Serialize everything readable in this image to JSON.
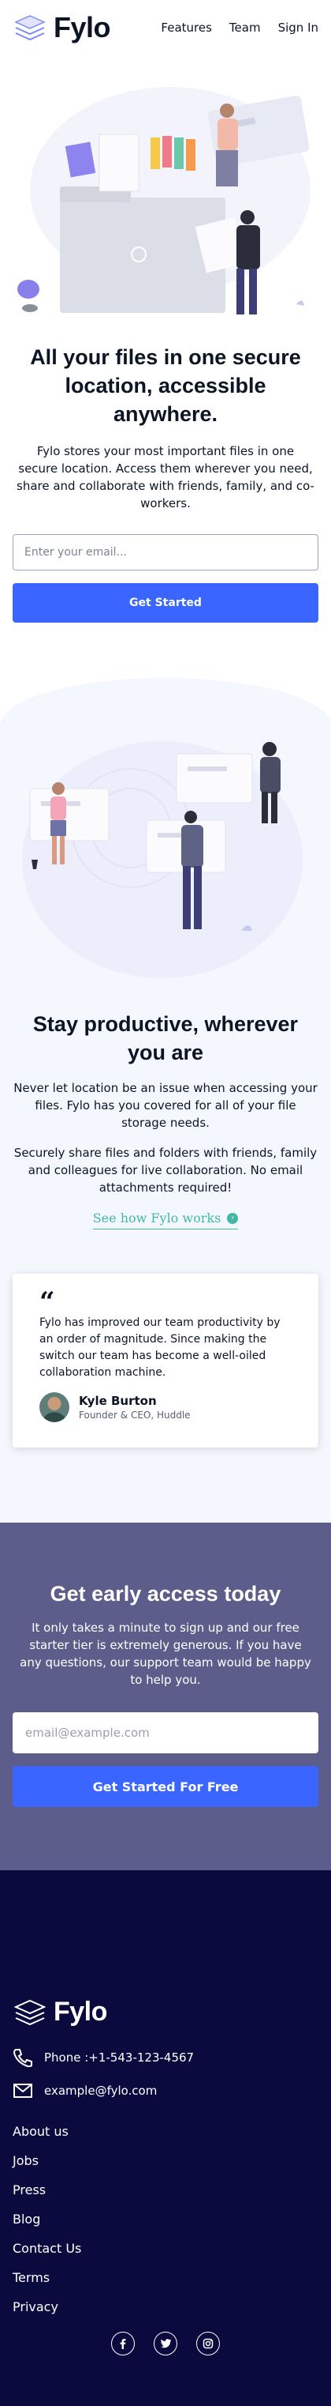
{
  "brand": {
    "name": "Fylo",
    "accent": "#3a66ff",
    "teal": "#3fb9a3",
    "cta_bg": "#5c5d8a",
    "footer_bg": "#0b0a3e"
  },
  "nav": {
    "features": "Features",
    "team": "Team",
    "signin": "Sign In"
  },
  "hero": {
    "title": "All your files in one secure location, accessible anywhere.",
    "body": "Fylo stores your most important files in one secure location. Access them wherever you need, share and collaborate with friends, family, and co-workers.",
    "email_placeholder": "Enter your email...",
    "button": "Get Started"
  },
  "productive": {
    "title": "Stay productive, wherever you are",
    "p1": "Never let location be an issue when accessing your files. Fylo has you covered for all of your file storage needs.",
    "p2": "Securely share files and folders with friends, family and colleagues for live collaboration. No email attachments required!",
    "link": "See how Fylo works"
  },
  "testimonial": {
    "quote": "Fylo has improved our team productivity by an order of magnitude. Since making the switch our team has become a well-oiled collaboration machine.",
    "name": "Kyle Burton",
    "role": "Founder & CEO, Huddle"
  },
  "cta": {
    "title": "Get early access today",
    "body": "It only takes a minute to sign up and our free starter tier is extremely generous. If you have any questions, our support team would be happy to help you.",
    "email_placeholder": "email@example.com",
    "button": "Get Started For Free"
  },
  "footer": {
    "phone": "Phone :+1-543-123-4567",
    "email": "example@fylo.com",
    "links": [
      "About us",
      "Jobs",
      "Press",
      "Blog",
      "Contact Us",
      "Terms",
      "Privacy"
    ],
    "social_icons": [
      "facebook-icon",
      "twitter-icon",
      "instagram-icon"
    ]
  }
}
